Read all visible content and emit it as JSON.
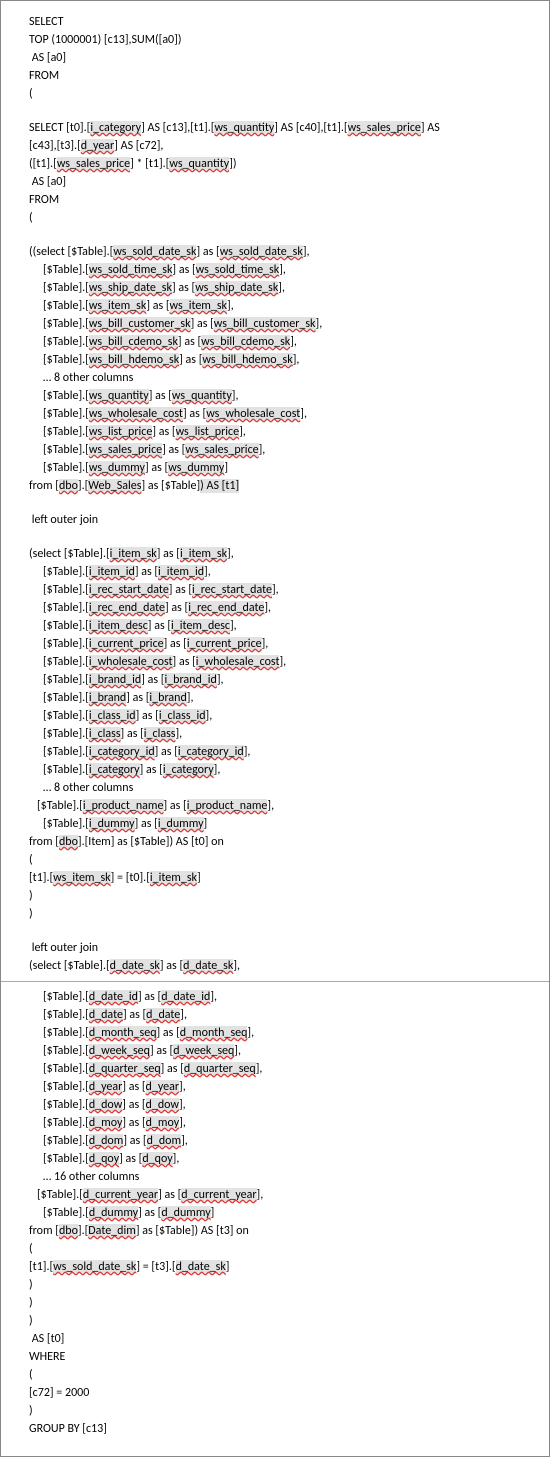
{
  "lines": [
    {
      "cls": "line",
      "parts": [
        {
          "t": "SELECT"
        }
      ]
    },
    {
      "cls": "line",
      "parts": [
        {
          "t": "TOP (1000001) [c13],SUM([a0])"
        }
      ]
    },
    {
      "cls": "line",
      "parts": [
        {
          "t": " AS [a0]"
        }
      ]
    },
    {
      "cls": "line",
      "parts": [
        {
          "t": "FROM"
        }
      ]
    },
    {
      "cls": "line",
      "parts": [
        {
          "t": "("
        }
      ]
    },
    {
      "cls": "blank"
    },
    {
      "cls": "line",
      "parts": [
        {
          "t": "SELECT [t0].["
        },
        {
          "t": "i_category",
          "hl": true
        },
        {
          "t": "] AS [c13],[t1].["
        },
        {
          "t": "ws_quantity",
          "hl": true
        },
        {
          "t": "] AS [c40],[t1].["
        },
        {
          "t": "ws_sales_price",
          "hl": true
        },
        {
          "t": "] AS "
        }
      ]
    },
    {
      "cls": "line",
      "parts": [
        {
          "t": "[c43],[t3].["
        },
        {
          "t": "d_year",
          "hl": true
        },
        {
          "t": "] AS [c72],"
        }
      ]
    },
    {
      "cls": "line",
      "parts": [
        {
          "t": "([t1].["
        },
        {
          "t": "ws_sales_price",
          "hl": true
        },
        {
          "t": "] * [t1].["
        },
        {
          "t": "ws_quantity",
          "hl": true
        },
        {
          "t": "])"
        }
      ]
    },
    {
      "cls": "line",
      "parts": [
        {
          "t": " AS [a0]"
        }
      ]
    },
    {
      "cls": "line",
      "parts": [
        {
          "t": "FROM"
        }
      ]
    },
    {
      "cls": "line",
      "parts": [
        {
          "t": "("
        }
      ]
    },
    {
      "cls": "blank"
    },
    {
      "cls": "line",
      "parts": [
        {
          "t": "((select [$Table].["
        },
        {
          "t": "ws_sold_date_sk",
          "hl": true
        },
        {
          "t": "] as ["
        },
        {
          "t": "ws_sold_date_sk",
          "hl": true
        },
        {
          "t": "],"
        }
      ]
    },
    {
      "cls": "line ind2",
      "parts": [
        {
          "t": "[$Table].["
        },
        {
          "t": "ws_sold_time_sk",
          "hl": true
        },
        {
          "t": "] as ["
        },
        {
          "t": "ws_sold_time_sk",
          "hl": true
        },
        {
          "t": "],"
        }
      ]
    },
    {
      "cls": "line ind2",
      "parts": [
        {
          "t": "[$Table].["
        },
        {
          "t": "ws_ship_date_sk",
          "hl": true
        },
        {
          "t": "] as ["
        },
        {
          "t": "ws_ship_date_sk",
          "hl": true
        },
        {
          "t": "],"
        }
      ]
    },
    {
      "cls": "line ind2",
      "parts": [
        {
          "t": "[$Table].["
        },
        {
          "t": "ws_item_sk",
          "hl": true
        },
        {
          "t": "] as ["
        },
        {
          "t": "ws_item_sk",
          "hl": true
        },
        {
          "t": "],"
        }
      ]
    },
    {
      "cls": "line ind2",
      "parts": [
        {
          "t": "[$Table].["
        },
        {
          "t": "ws_bill_customer_sk",
          "hl": true
        },
        {
          "t": "] as ["
        },
        {
          "t": "ws_bill_customer_sk",
          "hl": true
        },
        {
          "t": "],"
        }
      ]
    },
    {
      "cls": "line ind2",
      "parts": [
        {
          "t": "[$Table].["
        },
        {
          "t": "ws_bill_cdemo_sk",
          "hl": true
        },
        {
          "t": "] as ["
        },
        {
          "t": "ws_bill_cdemo_sk",
          "hl": true
        },
        {
          "t": "],"
        }
      ]
    },
    {
      "cls": "line ind2",
      "parts": [
        {
          "t": "[$Table].["
        },
        {
          "t": "ws_bill_hdemo_sk",
          "hl": true
        },
        {
          "t": "] as ["
        },
        {
          "t": "ws_bill_hdemo_sk",
          "hl": true
        },
        {
          "t": "],"
        }
      ]
    },
    {
      "cls": "line ind2",
      "parts": [
        {
          "t": "… 8 other columns"
        }
      ]
    },
    {
      "cls": "line ind2",
      "parts": [
        {
          "t": "[$Table].["
        },
        {
          "t": "ws_quantity",
          "hl": true
        },
        {
          "t": "] as ["
        },
        {
          "t": "ws_quantity",
          "hl": true
        },
        {
          "t": "],"
        }
      ]
    },
    {
      "cls": "line ind2",
      "parts": [
        {
          "t": "[$Table].["
        },
        {
          "t": "ws_wholesale_cost",
          "hl": true
        },
        {
          "t": "] as ["
        },
        {
          "t": "ws_wholesale_cost",
          "hl": true
        },
        {
          "t": "],"
        }
      ]
    },
    {
      "cls": "line ind2",
      "parts": [
        {
          "t": "[$Table].["
        },
        {
          "t": "ws_list_price",
          "hl": true
        },
        {
          "t": "] as ["
        },
        {
          "t": "ws_list_price",
          "hl": true
        },
        {
          "t": "],"
        }
      ]
    },
    {
      "cls": "line ind2",
      "parts": [
        {
          "t": "[$Table].["
        },
        {
          "t": "ws_sales_price",
          "hl": true
        },
        {
          "t": "] as ["
        },
        {
          "t": "ws_sales_price",
          "hl": true
        },
        {
          "t": "],"
        }
      ]
    },
    {
      "cls": "line ind2",
      "parts": [
        {
          "t": "[$Table].["
        },
        {
          "t": "ws_dummy",
          "hl": true
        },
        {
          "t": "] as ["
        },
        {
          "t": "ws_dummy",
          "hl": true
        },
        {
          "t": "]"
        }
      ]
    },
    {
      "cls": "line",
      "parts": [
        {
          "t": "from ["
        },
        {
          "t": "dbo",
          "hl": true
        },
        {
          "t": "].["
        },
        {
          "t": "Web_Sales",
          "hl": true
        },
        {
          "t": "] as [$Table]",
          "hlnou": false
        },
        {
          "t": ") AS [t1]",
          "hlnou": true
        }
      ]
    },
    {
      "cls": "blank"
    },
    {
      "cls": "line",
      "parts": [
        {
          "t": " left outer join"
        }
      ]
    },
    {
      "cls": "blank"
    },
    {
      "cls": "line",
      "parts": [
        {
          "t": "(select [$Table].["
        },
        {
          "t": "i_item_sk",
          "hl": true
        },
        {
          "t": "] as ["
        },
        {
          "t": "i_item_sk",
          "hl": true
        },
        {
          "t": "],"
        }
      ]
    },
    {
      "cls": "line ind2",
      "parts": [
        {
          "t": "[$Table].["
        },
        {
          "t": "i_item_id",
          "hl": true
        },
        {
          "t": "] as ["
        },
        {
          "t": "i_item_id",
          "hl": true
        },
        {
          "t": "],"
        }
      ]
    },
    {
      "cls": "line ind2",
      "parts": [
        {
          "t": "[$Table].["
        },
        {
          "t": "i_rec_start_date",
          "hl": true
        },
        {
          "t": "] as ["
        },
        {
          "t": "i_rec_start_date",
          "hl": true
        },
        {
          "t": "],"
        }
      ]
    },
    {
      "cls": "line ind2",
      "parts": [
        {
          "t": "[$Table].["
        },
        {
          "t": "i_rec_end_date",
          "hl": true
        },
        {
          "t": "] as ["
        },
        {
          "t": "i_rec_end_date",
          "hl": true
        },
        {
          "t": "],"
        }
      ]
    },
    {
      "cls": "line ind2",
      "parts": [
        {
          "t": "[$Table].["
        },
        {
          "t": "i_item_desc",
          "hl": true
        },
        {
          "t": "] as ["
        },
        {
          "t": "i_item_desc",
          "hl": true
        },
        {
          "t": "],"
        }
      ]
    },
    {
      "cls": "line ind2",
      "parts": [
        {
          "t": "[$Table].["
        },
        {
          "t": "i_current_price",
          "hl": true
        },
        {
          "t": "] as ["
        },
        {
          "t": "i_current_price",
          "hl": true
        },
        {
          "t": "],"
        }
      ]
    },
    {
      "cls": "line ind2",
      "parts": [
        {
          "t": "[$Table].["
        },
        {
          "t": "i_wholesale_cost",
          "hl": true
        },
        {
          "t": "] as ["
        },
        {
          "t": "i_wholesale_cost",
          "hl": true
        },
        {
          "t": "],"
        }
      ]
    },
    {
      "cls": "line ind2",
      "parts": [
        {
          "t": "[$Table].["
        },
        {
          "t": "i_brand_id",
          "hl": true
        },
        {
          "t": "] as ["
        },
        {
          "t": "i_brand_id",
          "hl": true
        },
        {
          "t": "],"
        }
      ]
    },
    {
      "cls": "line ind2",
      "parts": [
        {
          "t": "[$Table].["
        },
        {
          "t": "i_brand",
          "hl": true
        },
        {
          "t": "] as ["
        },
        {
          "t": "i_brand",
          "hl": true
        },
        {
          "t": "],"
        }
      ]
    },
    {
      "cls": "line ind2",
      "parts": [
        {
          "t": "[$Table].["
        },
        {
          "t": "i_class_id",
          "hl": true
        },
        {
          "t": "] as ["
        },
        {
          "t": "i_class_id",
          "hl": true
        },
        {
          "t": "],"
        }
      ]
    },
    {
      "cls": "line ind2",
      "parts": [
        {
          "t": "[$Table].["
        },
        {
          "t": "i_class",
          "hl": true
        },
        {
          "t": "] as ["
        },
        {
          "t": "i_class",
          "hl": true
        },
        {
          "t": "],"
        }
      ]
    },
    {
      "cls": "line ind2",
      "parts": [
        {
          "t": "[$Table].["
        },
        {
          "t": "i_category_id",
          "hl": true
        },
        {
          "t": "] as ["
        },
        {
          "t": "i_category_id",
          "hl": true
        },
        {
          "t": "],"
        }
      ]
    },
    {
      "cls": "line ind2",
      "parts": [
        {
          "t": "[$Table].["
        },
        {
          "t": "i_category",
          "hl": true
        },
        {
          "t": "] as ["
        },
        {
          "t": "i_category",
          "hl": true
        },
        {
          "t": "],"
        }
      ]
    },
    {
      "cls": "line ind2",
      "parts": [
        {
          "t": "… 8 other columns"
        }
      ]
    },
    {
      "cls": "line ind1",
      "parts": [
        {
          "t": "[$Table].["
        },
        {
          "t": "i_product_name",
          "hl": true
        },
        {
          "t": "] as ["
        },
        {
          "t": "i_product_name",
          "hl": true
        },
        {
          "t": "],"
        }
      ]
    },
    {
      "cls": "line ind2",
      "parts": [
        {
          "t": "[$Table].["
        },
        {
          "t": "i_dummy",
          "hl": true
        },
        {
          "t": "] as ["
        },
        {
          "t": "i_dummy",
          "hl": true
        },
        {
          "t": "]"
        }
      ]
    },
    {
      "cls": "line",
      "parts": [
        {
          "t": "from ["
        },
        {
          "t": "dbo",
          "hl": true
        },
        {
          "t": "].[Item] as [$Table]) AS [t0] on"
        }
      ]
    },
    {
      "cls": "line",
      "parts": [
        {
          "t": "("
        }
      ]
    },
    {
      "cls": "line",
      "parts": [
        {
          "t": "[t1].["
        },
        {
          "t": "ws_item_sk",
          "hl": true
        },
        {
          "t": "] = [t0].["
        },
        {
          "t": "i_item_sk",
          "hl": true
        },
        {
          "t": "]"
        }
      ]
    },
    {
      "cls": "line",
      "parts": [
        {
          "t": ")"
        }
      ]
    },
    {
      "cls": "line",
      "parts": [
        {
          "t": ")"
        }
      ]
    },
    {
      "cls": "blank"
    },
    {
      "cls": "line",
      "parts": [
        {
          "t": " left outer join"
        }
      ]
    },
    {
      "cls": "line",
      "parts": [
        {
          "t": "(select [$Table].["
        },
        {
          "t": "d_date_sk",
          "hl": true
        },
        {
          "t": "] as ["
        },
        {
          "t": "d_date_sk",
          "hl": true
        },
        {
          "t": "],"
        }
      ]
    },
    {
      "sep": true
    },
    {
      "cls": "line ind2",
      "parts": [
        {
          "t": "[$Table].["
        },
        {
          "t": "d_date_id",
          "hl": true
        },
        {
          "t": "] as ["
        },
        {
          "t": "d_date_id",
          "hl": true
        },
        {
          "t": "],"
        }
      ]
    },
    {
      "cls": "line ind2",
      "parts": [
        {
          "t": "[$Table].["
        },
        {
          "t": "d_date",
          "hl": true
        },
        {
          "t": "] as ["
        },
        {
          "t": "d_date",
          "hl": true
        },
        {
          "t": "],"
        }
      ]
    },
    {
      "cls": "line ind2",
      "parts": [
        {
          "t": "[$Table].["
        },
        {
          "t": "d_month_seq",
          "hl": true
        },
        {
          "t": "] as ["
        },
        {
          "t": "d_month_seq",
          "hl": true
        },
        {
          "t": "],"
        }
      ]
    },
    {
      "cls": "line ind2",
      "parts": [
        {
          "t": "[$Table].["
        },
        {
          "t": "d_week_seq",
          "hl": true
        },
        {
          "t": "] as ["
        },
        {
          "t": "d_week_seq",
          "hl": true
        },
        {
          "t": "],"
        }
      ]
    },
    {
      "cls": "line ind2",
      "parts": [
        {
          "t": "[$Table].["
        },
        {
          "t": "d_quarter_seq",
          "hl": true
        },
        {
          "t": "] as ["
        },
        {
          "t": "d_quarter_seq",
          "hl": true
        },
        {
          "t": "],"
        }
      ]
    },
    {
      "cls": "line ind2",
      "parts": [
        {
          "t": "[$Table].["
        },
        {
          "t": "d_year",
          "hl": true
        },
        {
          "t": "] as ["
        },
        {
          "t": "d_year",
          "hl": true
        },
        {
          "t": "],"
        }
      ]
    },
    {
      "cls": "line ind2",
      "parts": [
        {
          "t": "[$Table].["
        },
        {
          "t": "d_dow",
          "hl": true
        },
        {
          "t": "] as ["
        },
        {
          "t": "d_dow",
          "hl": true
        },
        {
          "t": "],"
        }
      ]
    },
    {
      "cls": "line ind2",
      "parts": [
        {
          "t": "[$Table].["
        },
        {
          "t": "d_moy",
          "hl": true
        },
        {
          "t": "] as ["
        },
        {
          "t": "d_moy",
          "hl": true
        },
        {
          "t": "],"
        }
      ]
    },
    {
      "cls": "line ind2",
      "parts": [
        {
          "t": "[$Table].["
        },
        {
          "t": "d_dom",
          "hl": true
        },
        {
          "t": "] as ["
        },
        {
          "t": "d_dom",
          "hl": true
        },
        {
          "t": "],"
        }
      ]
    },
    {
      "cls": "line ind2",
      "parts": [
        {
          "t": "[$Table].["
        },
        {
          "t": "d_qoy",
          "hl": true
        },
        {
          "t": "] as ["
        },
        {
          "t": "d_qoy",
          "hl": true
        },
        {
          "t": "],"
        }
      ]
    },
    {
      "cls": "line ind2",
      "parts": [
        {
          "t": "… 16 other columns"
        }
      ]
    },
    {
      "cls": "line ind1",
      "parts": [
        {
          "t": "[$Table].["
        },
        {
          "t": "d_current_year",
          "hl": true
        },
        {
          "t": "] as ["
        },
        {
          "t": "d_current_year",
          "hl": true
        },
        {
          "t": "],"
        }
      ]
    },
    {
      "cls": "line ind2",
      "parts": [
        {
          "t": "[$Table].["
        },
        {
          "t": "d_dummy",
          "hl": true
        },
        {
          "t": "] as ["
        },
        {
          "t": "d_dummy",
          "hl": true
        },
        {
          "t": "]"
        }
      ]
    },
    {
      "cls": "line",
      "parts": [
        {
          "t": "from ["
        },
        {
          "t": "dbo",
          "hl": true
        },
        {
          "t": "].["
        },
        {
          "t": "Date_dim",
          "hl": true
        },
        {
          "t": "] as [$Table]) AS [t3] on"
        }
      ]
    },
    {
      "cls": "line",
      "parts": [
        {
          "t": "("
        }
      ]
    },
    {
      "cls": "line",
      "parts": [
        {
          "t": "[t1].["
        },
        {
          "t": "ws_sold_date_sk",
          "hl": true
        },
        {
          "t": "] = [t3].["
        },
        {
          "t": "d_date_sk",
          "hl": true
        },
        {
          "t": "]"
        }
      ]
    },
    {
      "cls": "line",
      "parts": [
        {
          "t": ")"
        }
      ]
    },
    {
      "cls": "line",
      "parts": [
        {
          "t": ")"
        }
      ]
    },
    {
      "cls": "line",
      "parts": [
        {
          "t": ")"
        }
      ]
    },
    {
      "cls": "line",
      "parts": [
        {
          "t": " AS [t0]"
        }
      ]
    },
    {
      "cls": "line",
      "parts": [
        {
          "t": "WHERE"
        }
      ]
    },
    {
      "cls": "line",
      "parts": [
        {
          "t": "("
        }
      ]
    },
    {
      "cls": "line",
      "parts": [
        {
          "t": "[c72] = 2000"
        }
      ]
    },
    {
      "cls": "line",
      "parts": [
        {
          "t": ")"
        }
      ]
    },
    {
      "cls": "line",
      "parts": [
        {
          "t": "GROUP BY [c13]"
        }
      ]
    }
  ]
}
